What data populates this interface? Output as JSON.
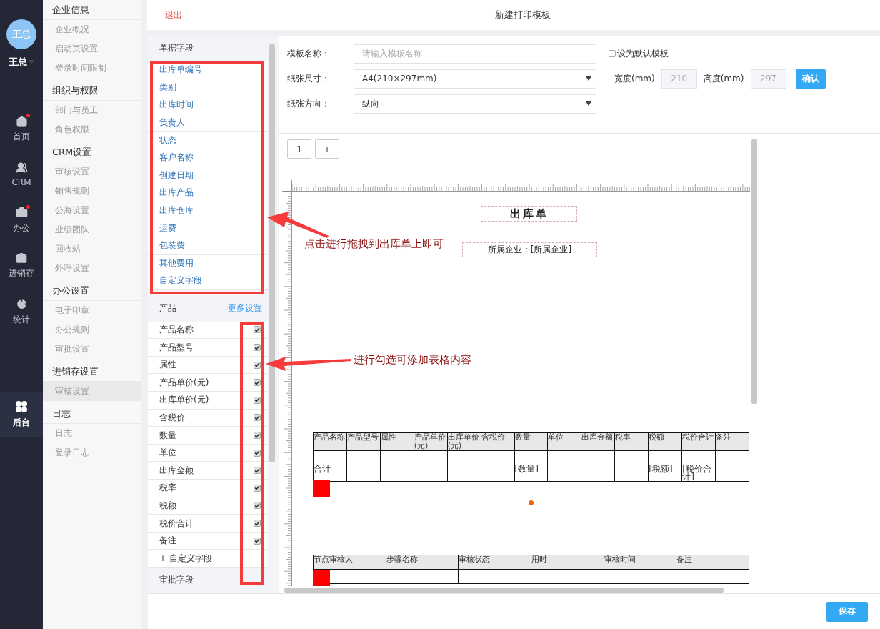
{
  "user": {
    "avatar": "王总",
    "name": "王总"
  },
  "nav": [
    {
      "label": "首页",
      "kind": "home",
      "badge": true,
      "selected": false
    },
    {
      "label": "CRM",
      "kind": "users",
      "badge": false,
      "selected": false
    },
    {
      "label": "办公",
      "kind": "briefcase",
      "badge": true,
      "selected": false
    },
    {
      "label": "进销存",
      "kind": "store",
      "badge": false,
      "selected": false
    },
    {
      "label": "统计",
      "kind": "pie",
      "badge": false,
      "selected": false
    },
    {
      "label": "后台",
      "kind": "clover",
      "badge": false,
      "selected": true
    }
  ],
  "submenu": [
    {
      "title": "企业信息",
      "items": [
        {
          "label": "企业概况",
          "selected": false
        },
        {
          "label": "启动页设置",
          "selected": false
        },
        {
          "label": "登录时间限制",
          "selected": false
        }
      ]
    },
    {
      "title": "组织与权限",
      "items": [
        {
          "label": "部门与员工",
          "selected": false
        },
        {
          "label": "角色权限",
          "selected": false
        }
      ]
    },
    {
      "title": "CRM设置",
      "items": [
        {
          "label": "审核设置",
          "selected": false
        },
        {
          "label": "销售规则",
          "selected": false
        },
        {
          "label": "公海设置",
          "selected": false
        },
        {
          "label": "业绩团队",
          "selected": false
        },
        {
          "label": "回收站",
          "selected": false
        },
        {
          "label": "外呼设置",
          "selected": false
        }
      ]
    },
    {
      "title": "办公设置",
      "items": [
        {
          "label": "电子印章",
          "selected": false
        },
        {
          "label": "办公规则",
          "selected": false
        },
        {
          "label": "审批设置",
          "selected": false
        }
      ]
    },
    {
      "title": "进销存设置",
      "items": [
        {
          "label": "审核设置",
          "selected": true
        }
      ]
    },
    {
      "title": "日志",
      "items": [
        {
          "label": "日志",
          "selected": false
        },
        {
          "label": "登录日志",
          "selected": false
        }
      ]
    }
  ],
  "header": {
    "back": "退出",
    "title": "新建打印模板"
  },
  "document_fields": {
    "title": "单据字段",
    "items": [
      "出库单编号",
      "类别",
      "出库时间",
      "负责人",
      "状态",
      "客户名称",
      "创建日期",
      "出库产品",
      "出库仓库",
      "运费",
      "包装费",
      "其他费用",
      "自定义字段"
    ]
  },
  "product_fields": {
    "title": "产品",
    "link": "更多设置",
    "items": [
      {
        "label": "产品名称",
        "checked": true
      },
      {
        "label": "产品型号",
        "checked": true
      },
      {
        "label": "属性",
        "checked": true
      },
      {
        "label": "产品单价(元)",
        "checked": true
      },
      {
        "label": "出库单价(元)",
        "checked": true
      },
      {
        "label": "含税价",
        "checked": true
      },
      {
        "label": "数量",
        "checked": true
      },
      {
        "label": "单位",
        "checked": true
      },
      {
        "label": "出库金额",
        "checked": true
      },
      {
        "label": "税率",
        "checked": true
      },
      {
        "label": "税额",
        "checked": true
      },
      {
        "label": "税价合计",
        "checked": true
      },
      {
        "label": "备注",
        "checked": true
      }
    ],
    "add": "+ 自定义字段"
  },
  "approval_fields": {
    "title": "审批字段"
  },
  "form": {
    "name_label": "模板名称：",
    "name_placeholder": "请输入模板名称",
    "default_checkbox": {
      "label": "设为默认模板",
      "checked": false
    },
    "size_label": "纸张尺寸：",
    "size_value": "A4(210×297mm)",
    "width_label": "宽度(mm)",
    "width_value": "210",
    "height_label": "高度(mm)",
    "height_value": "297",
    "dimensions_disabled": true,
    "confirm": "确认",
    "orientation_label": "纸张方向：",
    "orientation_value": "纵向"
  },
  "pages": [
    {
      "label": "1",
      "selected": false
    }
  ],
  "add_page": "+",
  "canvas": {
    "title": "出库单",
    "company": "所属企业：[所属企业]",
    "product_table": {
      "columns": [
        "产品名称",
        "产品型号",
        "属性",
        "产品单价(元)",
        "出库单价(元)",
        "含税价",
        "数量",
        "单位",
        "出库金额",
        "税率",
        "税额",
        "税价合计",
        "备注"
      ],
      "rows": [
        [
          "",
          "",
          "",
          "",
          "",
          "",
          "",
          "",
          "",
          "",
          "",
          "",
          ""
        ],
        [
          "合计",
          "",
          "",
          "",
          "",
          "",
          "[数量]",
          "",
          "",
          "",
          "[税额]",
          "[税价合计]",
          ""
        ]
      ]
    },
    "approval_table": {
      "columns": [
        "节点审核人",
        "步骤名称",
        "审核状态",
        "用时",
        "审核时间",
        "备注"
      ],
      "rows": [
        [
          "",
          "",
          "",
          "",
          "",
          ""
        ]
      ]
    }
  },
  "annotations": [
    {
      "text": "点击进行拖拽到出库单上即可"
    },
    {
      "text": "进行勾选可添加表格内容"
    }
  ],
  "save": "保存"
}
